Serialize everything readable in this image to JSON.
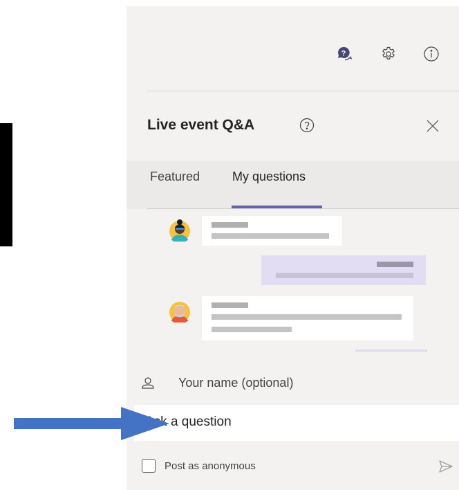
{
  "panel": {
    "title": "Live event Q&A",
    "tabs": [
      {
        "label": "Featured",
        "selected": false
      },
      {
        "label": "My questions",
        "selected": true
      }
    ]
  },
  "topbar": {
    "icons": [
      "qa-chat-icon",
      "settings-gear-icon",
      "info-icon"
    ],
    "accent": "#464775"
  },
  "compose": {
    "name_placeholder": "Your name (optional)",
    "question_placeholder": "Ask a question",
    "anonymous_label": "Post as anonymous"
  },
  "colors": {
    "accent": "#6264a7",
    "panel_bg": "#f3f2f1",
    "my_message_bg": "#e2ddf2",
    "annotation_arrow": "#4472c4"
  }
}
